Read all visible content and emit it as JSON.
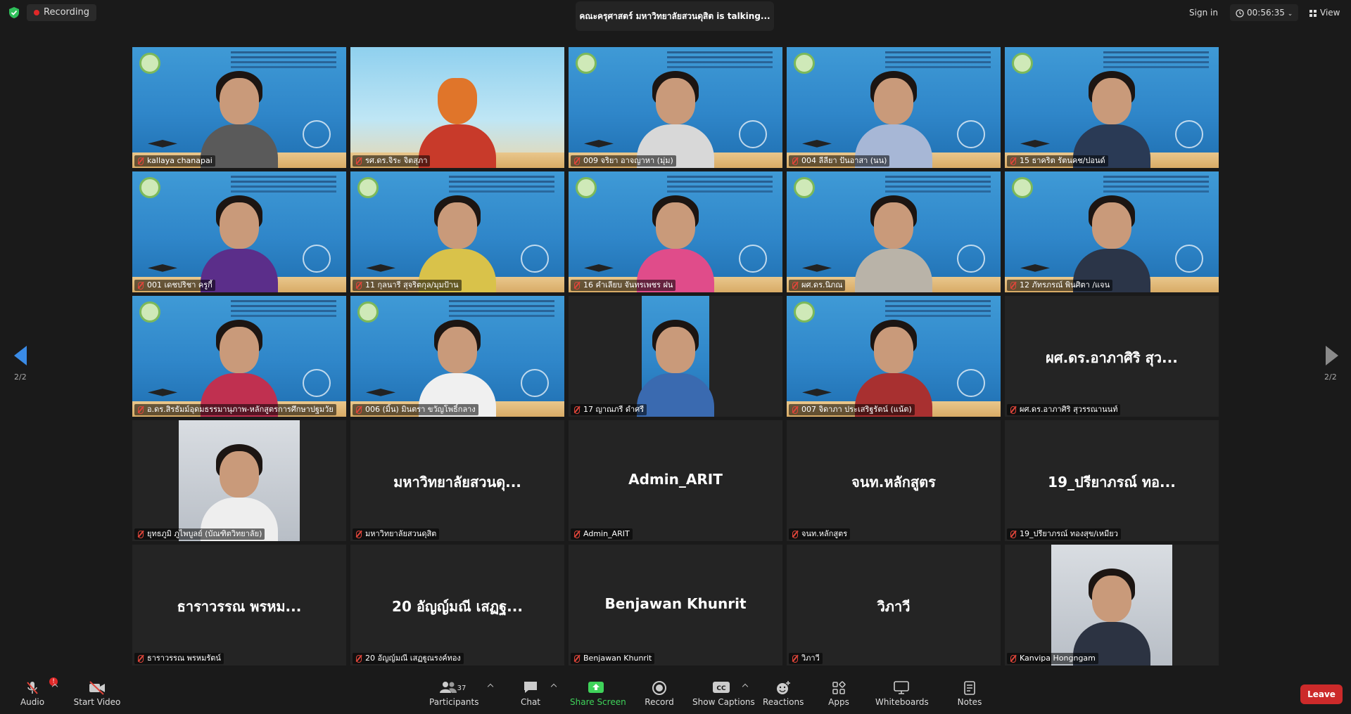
{
  "top": {
    "recording": "Recording",
    "talking": "คณะครุศาสตร์ มหาวิทยาลัยสวนดุสิต is talking...",
    "sign_in": "Sign in",
    "timer": "00:56:35",
    "view": "View"
  },
  "nav": {
    "page_left": "2/2",
    "page_right": "2/2"
  },
  "tiles": [
    {
      "name": "kallaya chanapai",
      "big": ""
    },
    {
      "name": "รศ.ดร.จิระ จิตสุภา",
      "big": ""
    },
    {
      "name": "009 จริยา อาจญาหา (มุ่ม)",
      "big": ""
    },
    {
      "name": "004 ลีลียา ปันอาสา (นน)",
      "big": ""
    },
    {
      "name": "15 ธาคริต รัตนคช/ปอนด์",
      "big": ""
    },
    {
      "name": "001 เดชปริชา ครูกี้",
      "big": ""
    },
    {
      "name": "11 กุลนารี สุจริตกุล/มุมป้าน",
      "big": ""
    },
    {
      "name": "16 คำเลียบ จันทรเพชร ฝน",
      "big": ""
    },
    {
      "name": "ผศ.ดร.นิภณ",
      "big": ""
    },
    {
      "name": "12 ภัทรภรณ์ พินศิตา /แจน",
      "big": ""
    },
    {
      "name": "อ.ดร.สิรธัมม์อุดมธรรมานุภาพ-หลักสูตรการศึกษาปฐมวัย",
      "big": ""
    },
    {
      "name": "006 (มิ้น) มินตรา ขวัญโพธิ์กลาง",
      "big": ""
    },
    {
      "name": "17 ญาณภรี ดำศรี",
      "big": ""
    },
    {
      "name": "007 จิดาภา ประเสริฐรัตน์ (แน้ต)",
      "big": ""
    },
    {
      "name": "ผศ.ดร.อาภาศิริ สุวรรณานนท์",
      "big": "ผศ.ดร.อาภาศิริ สุว..."
    },
    {
      "name": "ยุทธภูมิ ภูไพบูลย์ (บัณฑิตวิทยาลัย)",
      "big": ""
    },
    {
      "name": "มหาวิทยาลัยสวนดุสิต",
      "big": "มหาวิทยาลัยสวนดุ..."
    },
    {
      "name": "Admin_ARIT",
      "big": "Admin_ARIT"
    },
    {
      "name": "จนท.หลักสูตร",
      "big": "จนท.หลักสูตร"
    },
    {
      "name": "19_ปรียาภรณ์ ทองสุข/เหมียว",
      "big": "19_ปรียาภรณ์ ทอ..."
    },
    {
      "name": "ธาราวรรณ พรหมรัตน์",
      "big": "ธาราวรรณ พรหม..."
    },
    {
      "name": "20 อัญญ์มณี เสฏฐูณรงค์ทอง",
      "big": "20 อัญญ์มณี เสฏฐ..."
    },
    {
      "name": "Benjawan Khunrit",
      "big": "Benjawan Khunrit"
    },
    {
      "name": "วิภาวี",
      "big": "วิภาวี"
    },
    {
      "name": "Kanvipa Hongngam",
      "big": ""
    }
  ],
  "toolbar": {
    "audio": "Audio",
    "audio_badge": "!",
    "start_video": "Start Video",
    "participants": "Participants",
    "participants_count": "37",
    "chat": "Chat",
    "share_screen": "Share Screen",
    "record": "Record",
    "show_captions": "Show Captions",
    "reactions": "Reactions",
    "apps": "Apps",
    "whiteboards": "Whiteboards",
    "notes": "Notes",
    "leave": "Leave"
  },
  "colors": {
    "accent": "#3a8be6",
    "share_green": "#3fd35a",
    "leave_red": "#cc2a2a",
    "mic_off_red": "#e0453a"
  }
}
